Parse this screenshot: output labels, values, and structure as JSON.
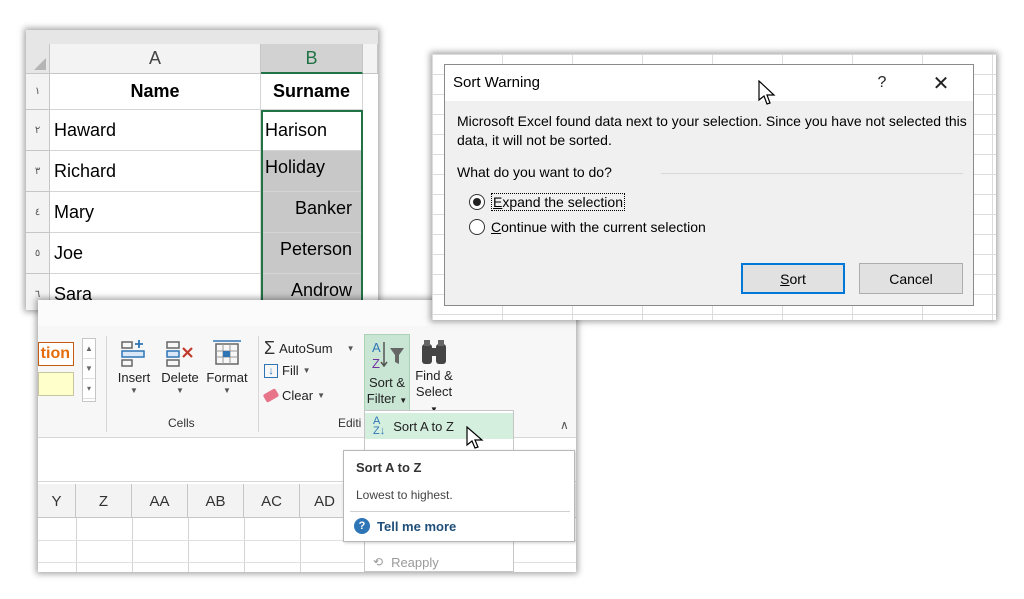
{
  "spreadsheet": {
    "columns": [
      "A",
      "B"
    ],
    "row_numbers": [
      "١",
      "٢",
      "٣",
      "٤",
      "٥",
      "٦"
    ],
    "header_name": "Name",
    "header_surname": "Surname",
    "names": [
      "Haward",
      "Richard",
      "Mary",
      "Joe",
      "Sara"
    ],
    "surnames": [
      "Harison",
      "Holiday",
      "Banker",
      "Peterson",
      "Androw"
    ],
    "accent_color": "#217346"
  },
  "ribbon": {
    "style_label": "tion",
    "insert_label": "Insert",
    "delete_label": "Delete",
    "format_label": "Format",
    "cells_group": "Cells",
    "autosum_label": "AutoSum",
    "fill_label": "Fill",
    "clear_label": "Clear",
    "editing_group": "Editi",
    "sort_filter_line1": "Sort &",
    "sort_filter_line2": "Filter",
    "find_select_line1": "Find &",
    "find_select_line2": "Select",
    "menu_sort_az": "Sort A to Z",
    "menu_reapply": "Reapply",
    "highlight_color": "#c9e6d5"
  },
  "sheet_columns": [
    "Y",
    "Z",
    "AA",
    "AB",
    "AC",
    "AD"
  ],
  "tooltip": {
    "title": "Sort A to Z",
    "body": "Lowest to highest.",
    "link": "Tell me more",
    "link_icon": "question-icon"
  },
  "dialog": {
    "title": "Sort Warning",
    "help": "?",
    "close": "✕",
    "message": "Microsoft Excel found data next to your selection.  Since you have not selected this data, it will not be sorted.",
    "question": "What do you want to do?",
    "option1_key": "E",
    "option1_rest": "xpand the selection",
    "option2_key": "C",
    "option2_rest": "ontinue with the current selection",
    "sort_key": "S",
    "sort_rest": "ort",
    "cancel": "Cancel",
    "selected_option": "expand"
  }
}
